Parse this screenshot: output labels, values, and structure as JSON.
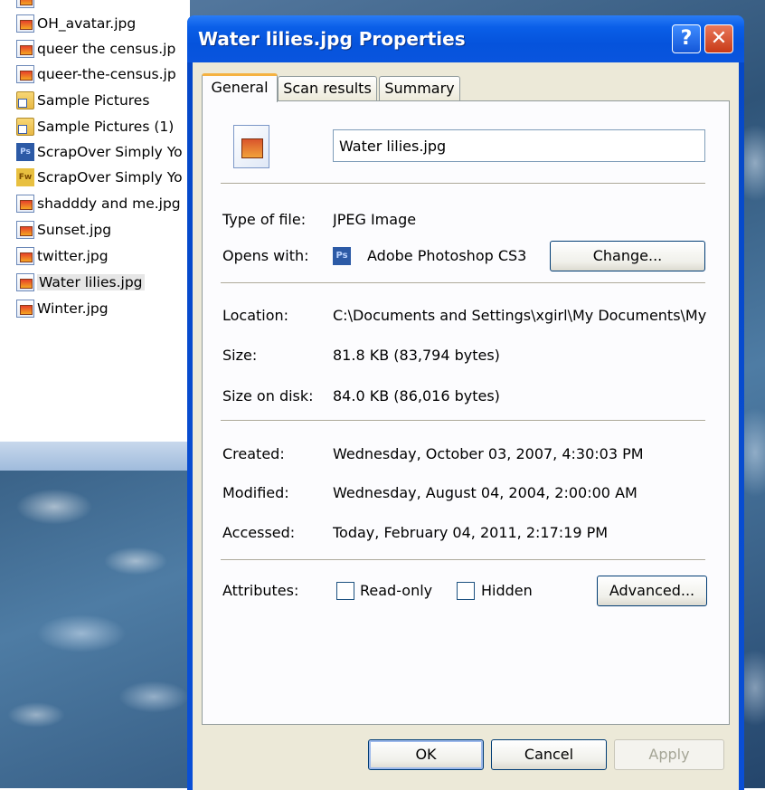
{
  "explorer": {
    "files": [
      {
        "name": "OH_avatar.jpg",
        "icon": "jpg-file-icon"
      },
      {
        "name": "queer the census.jp",
        "icon": "jpg-file-icon"
      },
      {
        "name": "queer-the-census.jp",
        "icon": "jpg-file-icon"
      },
      {
        "name": "Sample Pictures",
        "icon": "folder-shortcut-icon"
      },
      {
        "name": "Sample Pictures (1)",
        "icon": "folder-shortcut-icon"
      },
      {
        "name": "ScrapOver Simply Yo",
        "icon": "photoshop-file-icon"
      },
      {
        "name": "ScrapOver Simply Yo",
        "icon": "fireworks-file-icon"
      },
      {
        "name": "shadddy and me.jpg",
        "icon": "jpg-file-icon"
      },
      {
        "name": "Sunset.jpg",
        "icon": "jpg-file-icon"
      },
      {
        "name": "twitter.jpg",
        "icon": "jpg-file-icon"
      },
      {
        "name": "Water lilies.jpg",
        "icon": "jpg-file-icon",
        "selected": true
      },
      {
        "name": "Winter.jpg",
        "icon": "jpg-file-icon"
      }
    ]
  },
  "dialog": {
    "title": "Water lilies.jpg Properties",
    "help_glyph": "?",
    "close_glyph": "✕",
    "tabs": [
      "General",
      "Scan results",
      "Summary"
    ],
    "active_tab": "General",
    "file_name": "Water lilies.jpg",
    "type_label": "Type of file:",
    "type_value": "JPEG Image",
    "opens_label": "Opens with:",
    "opens_app_icon_text": "Ps",
    "opens_value": "Adobe Photoshop CS3",
    "change_button": "Change...",
    "location_label": "Location:",
    "location_value": "C:\\Documents and Settings\\xgirl\\My Documents\\My",
    "size_label": "Size:",
    "size_value": "81.8 KB (83,794 bytes)",
    "size_disk_label": "Size on disk:",
    "size_disk_value": "84.0 KB (86,016 bytes)",
    "created_label": "Created:",
    "created_value": "Wednesday, October 03, 2007, 4:30:03 PM",
    "modified_label": "Modified:",
    "modified_value": "Wednesday, August 04, 2004, 2:00:00 AM",
    "accessed_label": "Accessed:",
    "accessed_value": "Today, February 04, 2011, 2:17:19 PM",
    "attributes_label": "Attributes:",
    "readonly_label": "Read-only",
    "hidden_label": "Hidden",
    "advanced_button": "Advanced...",
    "ok_button": "OK",
    "cancel_button": "Cancel",
    "apply_button": "Apply"
  },
  "colors": {
    "titlebar_blue": "#0a5fe8",
    "dialog_face": "#ece9d8",
    "tab_highlight": "#f5b241",
    "close_red": "#c83a17"
  }
}
